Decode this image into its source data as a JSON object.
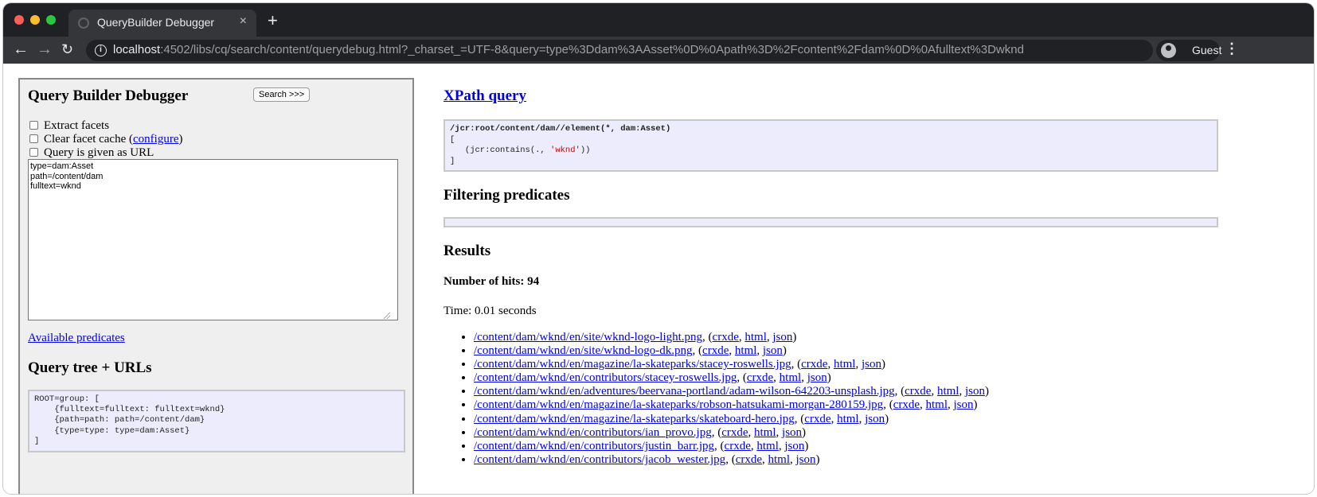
{
  "browser": {
    "tab_title": "QueryBuilder Debugger",
    "tab_close": "×",
    "new_tab": "+",
    "url_host": "localhost",
    "url_rest": ":4502/libs/cq/search/content/querydebug.html?_charset_=UTF-8&query=type%3Ddam%3AAsset%0D%0Apath%3D%2Fcontent%2Fdam%0D%0Afulltext%3Dwknd",
    "profile_label": "Guest",
    "back": "←",
    "forward": "→",
    "reload": "↻",
    "info": "i",
    "menu": "⋮"
  },
  "left": {
    "title": "Query Builder Debugger",
    "search_button": "Search >>>",
    "extract_facets": "Extract facets",
    "clear_cache_prefix": "Clear facet cache (",
    "configure_link": "configure",
    "clear_cache_suffix": ")",
    "query_as_url": "Query is given as URL",
    "query_text": "type=dam:Asset\npath=/content/dam\nfulltext=wknd",
    "available_predicates": "Available predicates",
    "tree_title": "Query tree + URLs",
    "tree_text": "ROOT=group: [\n    {fulltext=fulltext: fulltext=wknd}\n    {path=path: path=/content/dam}\n    {type=type: type=dam:Asset}\n]"
  },
  "right": {
    "xpath_title": "XPath query",
    "xpath_line1": "/jcr:root/content/dam//element(*, dam:Asset)",
    "xpath_line2": "[",
    "xpath_line3_prefix": "   (jcr:contains(., ",
    "xpath_line3_string": "'wknd'",
    "xpath_line3_suffix": "))",
    "xpath_line4": "]",
    "filtering_title": "Filtering predicates",
    "results_title": "Results",
    "hits_label": "Number of hits: 94",
    "time_label": "Time: 0.01 seconds",
    "link_crxde": "crxde",
    "link_html": "html",
    "link_json": "json",
    "results": [
      "/content/dam/wknd/en/site/wknd-logo-light.png",
      "/content/dam/wknd/en/site/wknd-logo-dk.png",
      "/content/dam/wknd/en/magazine/la-skateparks/stacey-roswells.jpg",
      "/content/dam/wknd/en/contributors/stacey-roswells.jpg",
      "/content/dam/wknd/en/adventures/beervana-portland/adam-wilson-642203-unsplash.jpg",
      "/content/dam/wknd/en/magazine/la-skateparks/robson-hatsukami-morgan-280159.jpg",
      "/content/dam/wknd/en/magazine/la-skateparks/skateboard-hero.jpg",
      "/content/dam/wknd/en/contributors/ian_provo.jpg",
      "/content/dam/wknd/en/contributors/justin_barr.jpg",
      "/content/dam/wknd/en/contributors/jacob_wester.jpg"
    ]
  }
}
